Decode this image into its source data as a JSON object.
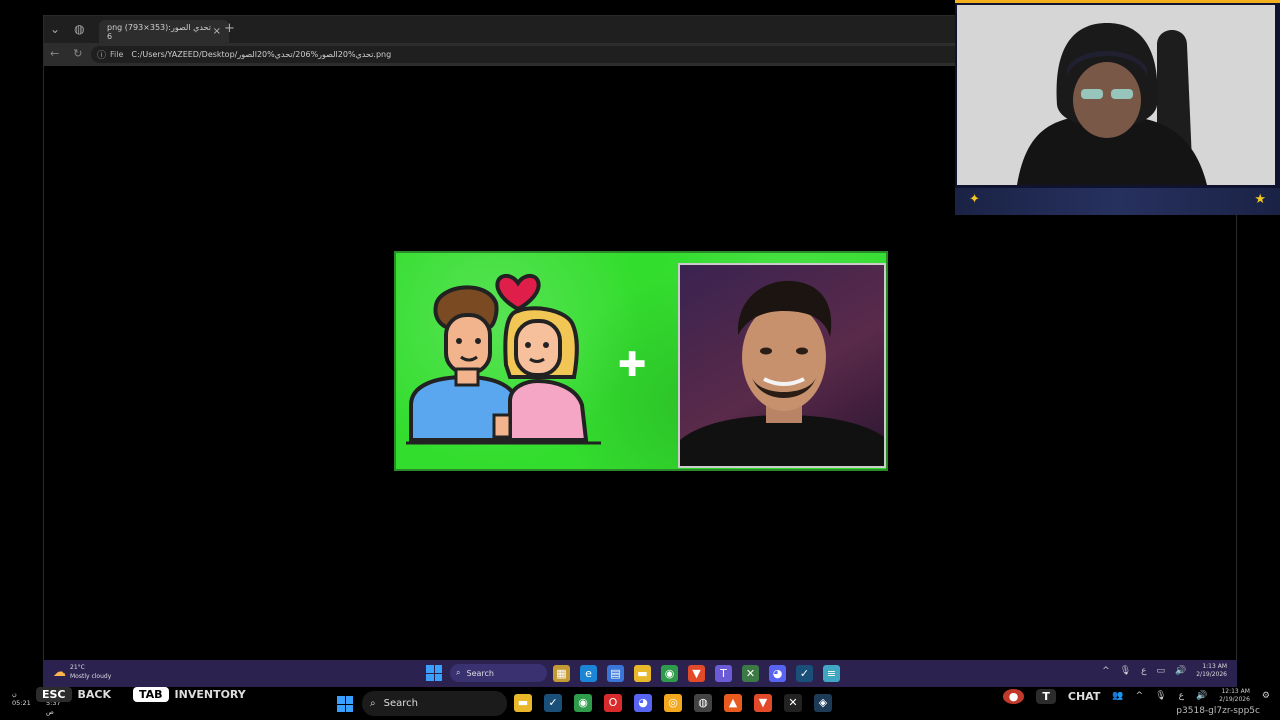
{
  "browser": {
    "tab_title": "png (793×353):تحدي الصور 6",
    "tab_close": "×",
    "new_tab": "+",
    "url_label": "File",
    "url": "C:/Users/YAZEED/Desktop/تحدي%20الصور%206/تحدي%20الصور.png"
  },
  "webcam": {
    "icon_left": "lightning-badge-icon",
    "icon_right": "star-icon"
  },
  "inner_taskbar": {
    "weather_temp": "21°C",
    "weather_desc": "Mostly cloudy",
    "search_label": "Search",
    "time": "1:13 AM",
    "date": "2/19/2026",
    "lang": "ع"
  },
  "outer_taskbar": {
    "clock_line1": "ن",
    "clock_line2": "05:21",
    "clock_line3": "5:37 ص",
    "esc_key": "ESC",
    "back_label": "BACK",
    "tab_key": "TAB",
    "inventory_label": "INVENTORY",
    "search_label": "Search",
    "chat_key": "T",
    "chat_label": "CHAT",
    "time": "12:13 AM",
    "date": "2/19/2026",
    "lang": "ع",
    "code": "p3518-gl7zr-spp5c"
  },
  "colors": {
    "image_bg": "#33dd2e",
    "webcam_accent": "#f2b01e",
    "inner_taskbar_bg": "#2b2250"
  }
}
